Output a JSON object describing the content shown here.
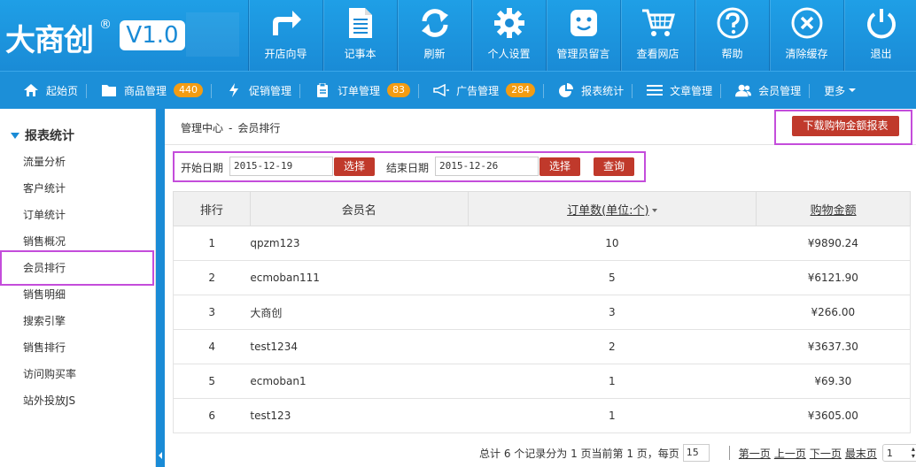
{
  "brand": {
    "name": "大商创",
    "reg": "®",
    "version": "V1.0"
  },
  "topnav": [
    {
      "label": "开店向导",
      "icon": "arrow-turn-icon"
    },
    {
      "label": "记事本",
      "icon": "notebook-icon"
    },
    {
      "label": "刷新",
      "icon": "refresh-icon"
    },
    {
      "label": "个人设置",
      "icon": "gear-icon"
    },
    {
      "label": "管理员留言",
      "icon": "chat-icon"
    },
    {
      "label": "查看网店",
      "icon": "cart-icon"
    },
    {
      "label": "帮助",
      "icon": "help-icon"
    },
    {
      "label": "清除缓存",
      "icon": "close-icon"
    },
    {
      "label": "退出",
      "icon": "power-icon"
    }
  ],
  "subnav": [
    {
      "label": "起始页",
      "icon": "home-icon",
      "badge": ""
    },
    {
      "label": "商品管理",
      "icon": "folder-icon",
      "badge": "440"
    },
    {
      "label": "促销管理",
      "icon": "bolt-icon",
      "badge": ""
    },
    {
      "label": "订单管理",
      "icon": "clipboard-icon",
      "badge": "83"
    },
    {
      "label": "广告管理",
      "icon": "megaphone-icon",
      "badge": "284"
    },
    {
      "label": "报表统计",
      "icon": "pie-chart-icon",
      "badge": ""
    },
    {
      "label": "文章管理",
      "icon": "list-icon",
      "badge": ""
    },
    {
      "label": "会员管理",
      "icon": "users-icon",
      "badge": ""
    },
    {
      "label": "更多",
      "icon": "",
      "badge": ""
    }
  ],
  "sidebar": {
    "heading": "报表统计",
    "items": [
      "流量分析",
      "客户统计",
      "订单统计",
      "销售概况",
      "会员排行",
      "销售明细",
      "搜索引擎",
      "销售排行",
      "访问购买率",
      "站外投放JS"
    ],
    "active_index": 4
  },
  "breadcrumb": {
    "root": "管理中心",
    "sep": "-",
    "current": "会员排行"
  },
  "download_button": "下载购物金额报表",
  "filter": {
    "start_label": "开始日期",
    "start_value": "2015-12-19",
    "end_label": "结束日期",
    "end_value": "2015-12-26",
    "select_label": "选择",
    "query_label": "查询"
  },
  "table": {
    "columns": [
      "排行",
      "会员名",
      "订单数(单位:个)",
      "购物金额"
    ],
    "rows": [
      [
        "1",
        "qpzm123",
        "10",
        "¥9890.24"
      ],
      [
        "2",
        "ecmoban111",
        "5",
        "¥6121.90"
      ],
      [
        "3",
        "大商创",
        "3",
        "¥266.00"
      ],
      [
        "4",
        "test1234",
        "2",
        "¥3637.30"
      ],
      [
        "5",
        "ecmoban1",
        "1",
        "¥69.30"
      ],
      [
        "6",
        "test123",
        "1",
        "¥3605.00"
      ]
    ]
  },
  "pager": {
    "summary": "总计 6 个记录分为 1 页当前第 1 页，每页",
    "page_size": "15",
    "first": "第一页",
    "prev": "上一页",
    "next": "下一页",
    "last": "最末页",
    "page_select": "1"
  }
}
